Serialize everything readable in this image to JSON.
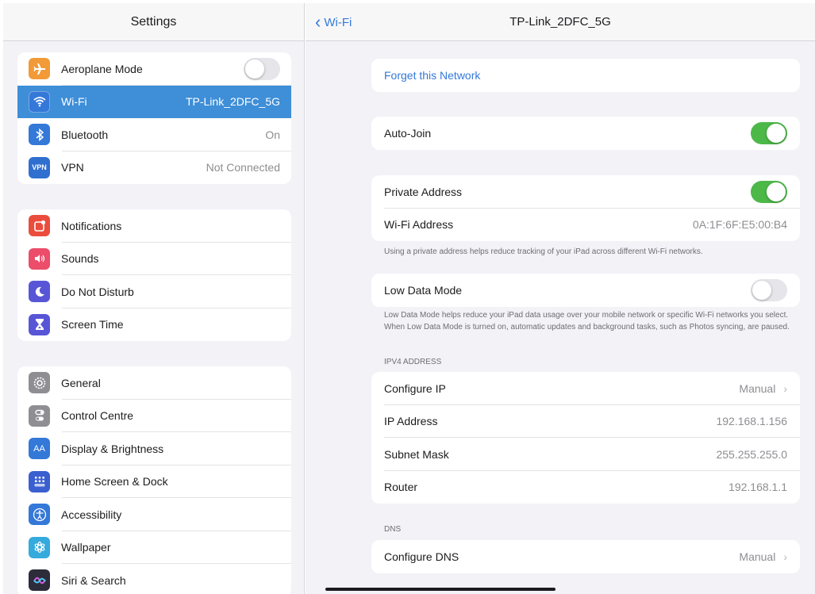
{
  "sidebar": {
    "title": "Settings",
    "group1": [
      {
        "label": "Aeroplane Mode",
        "icon": "airplane-icon",
        "color": "#f19a37",
        "toggle": false
      },
      {
        "label": "Wi-Fi",
        "icon": "wifi-icon",
        "color": "#3478d8",
        "value": "TP-Link_2DFC_5G",
        "selected": true
      },
      {
        "label": "Bluetooth",
        "icon": "bluetooth-icon",
        "color": "#3478d8",
        "value": "On"
      },
      {
        "label": "VPN",
        "icon": "vpn-icon",
        "icon_text": "VPN",
        "color": "#2f6fd0",
        "value": "Not Connected"
      }
    ],
    "group2": [
      {
        "label": "Notifications",
        "icon": "notifications-icon",
        "color": "#eb4d3d"
      },
      {
        "label": "Sounds",
        "icon": "sounds-icon",
        "color": "#eb4d6a"
      },
      {
        "label": "Do Not Disturb",
        "icon": "moon-icon",
        "color": "#5856d6"
      },
      {
        "label": "Screen Time",
        "icon": "hourglass-icon",
        "color": "#5856d6"
      }
    ],
    "group3": [
      {
        "label": "General",
        "icon": "gear-icon",
        "color": "#8e8e93"
      },
      {
        "label": "Control Centre",
        "icon": "control-centre-icon",
        "color": "#8e8e93"
      },
      {
        "label": "Display & Brightness",
        "icon": "display-icon",
        "icon_text": "AA",
        "color": "#3478d8"
      },
      {
        "label": "Home Screen & Dock",
        "icon": "home-screen-icon",
        "color": "#3a5fd0"
      },
      {
        "label": "Accessibility",
        "icon": "accessibility-icon",
        "color": "#3478d8"
      },
      {
        "label": "Wallpaper",
        "icon": "wallpaper-icon",
        "color": "#35aadc"
      },
      {
        "label": "Siri & Search",
        "icon": "siri-icon",
        "color": "#2c2c3a"
      }
    ]
  },
  "detail": {
    "back_label": "Wi-Fi",
    "title": "TP-Link_2DFC_5G",
    "forget_label": "Forget this Network",
    "auto_join_label": "Auto-Join",
    "auto_join_on": true,
    "private_address_label": "Private Address",
    "private_address_on": true,
    "wifi_address_label": "Wi-Fi Address",
    "wifi_address_value": "0A:1F:6F:E5:00:B4",
    "private_note": "Using a private address helps reduce tracking of your iPad across different Wi-Fi networks.",
    "low_data_label": "Low Data Mode",
    "low_data_on": false,
    "low_data_note": "Low Data Mode helps reduce your iPad data usage over your mobile network or specific Wi-Fi networks you select. When Low Data Mode is turned on, automatic updates and background tasks, such as Photos syncing, are paused.",
    "ipv4_header": "IPV4 ADDRESS",
    "configure_ip_label": "Configure IP",
    "configure_ip_value": "Manual",
    "ip_address_label": "IP Address",
    "ip_address_value": "192.168.1.156",
    "subnet_label": "Subnet Mask",
    "subnet_value": "255.255.255.0",
    "router_label": "Router",
    "router_value": "192.168.1.1",
    "dns_header": "DNS",
    "configure_dns_label": "Configure DNS",
    "configure_dns_value": "Manual"
  },
  "colors": {
    "accent": "#3478d8",
    "toggle_on": "#4cb848",
    "selected_row": "#3e8ed8"
  }
}
